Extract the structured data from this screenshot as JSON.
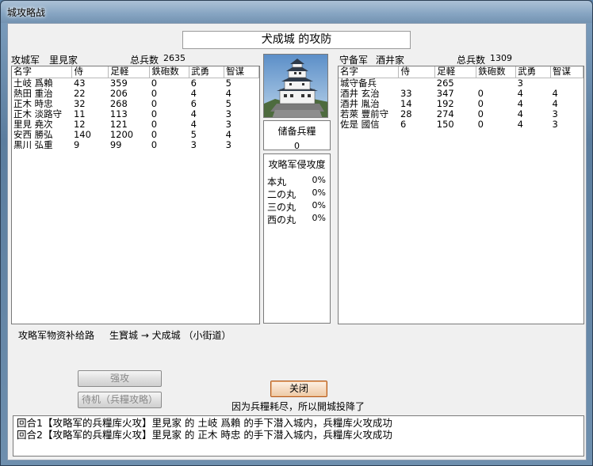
{
  "window": {
    "title": "城攻略战"
  },
  "castle_title": "犬成城 的攻防",
  "attacker": {
    "label": "攻城军",
    "clan": "里見家",
    "total_label": "总兵数",
    "total": "2635",
    "columns": [
      "名字",
      "侍",
      "足軽",
      "鉄砲数",
      "武勇",
      "智谋"
    ],
    "rows": [
      [
        "土岐 爲賴",
        "43",
        "359",
        "0",
        "6",
        "5"
      ],
      [
        "熱田 重治",
        "22",
        "206",
        "0",
        "4",
        "4"
      ],
      [
        "正木 時忠",
        "32",
        "268",
        "0",
        "6",
        "5"
      ],
      [
        "正木 淡路守",
        "11",
        "113",
        "0",
        "4",
        "3"
      ],
      [
        "里見 堯次",
        "12",
        "121",
        "0",
        "4",
        "3"
      ],
      [
        "安西 勝弘",
        "140",
        "1200",
        "0",
        "5",
        "4"
      ],
      [
        "黒川 弘重",
        "9",
        "99",
        "0",
        "3",
        "3"
      ]
    ]
  },
  "defender": {
    "label": "守备军",
    "clan": "酒井家",
    "total_label": "总兵数",
    "total": "1309",
    "columns": [
      "名字",
      "侍",
      "足軽",
      "鉄砲数",
      "武勇",
      "智谋"
    ],
    "rows": [
      [
        "城守备兵",
        "",
        "265",
        "",
        "3",
        ""
      ],
      [
        "酒井 玄治",
        "33",
        "347",
        "0",
        "4",
        "4"
      ],
      [
        "酒井 胤治",
        "14",
        "192",
        "0",
        "4",
        "4"
      ],
      [
        "若萊 豐前守",
        "28",
        "274",
        "0",
        "4",
        "3"
      ],
      [
        "佐是 國信",
        "6",
        "150",
        "0",
        "4",
        "3"
      ]
    ]
  },
  "storage": {
    "label": "储备兵糧",
    "value": "0"
  },
  "invasion": {
    "label": "攻略军侵攻度",
    "items": [
      {
        "name": "本丸",
        "value": "0%"
      },
      {
        "name": "二の丸",
        "value": "0%"
      },
      {
        "name": "三の丸",
        "value": "0%"
      },
      {
        "name": "西の丸",
        "value": "0%"
      }
    ]
  },
  "supply": {
    "label": "攻略军物资补给路",
    "route": "生寳城 → 犬成城 （小街道）"
  },
  "buttons": {
    "assault": "强攻",
    "wait": "待机（兵糧攻略）",
    "close": "关闭"
  },
  "result_message": "因为兵糧耗尽，所以開城投降了",
  "log": [
    "回合1【攻略军的兵糧库火攻】里見家 的 土岐 爲賴 的手下潜入城内，兵糧库火攻成功",
    "回合2【攻略军的兵糧库火攻】里見家 的 正木 時忠 的手下潜入城内，兵糧库火攻成功"
  ],
  "colors": {
    "titlebar": "#6e8fae",
    "client_bg": "#f0f0f0",
    "close_button_border": "#b05a1c"
  }
}
